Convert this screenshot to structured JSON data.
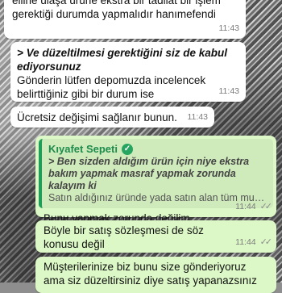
{
  "messages": [
    {
      "text": "elline ulaşa ürüne ekstra bir tadilat bir işlem gerektiği durumda yapmalıdır hanımefendi",
      "time": "11:43"
    },
    {
      "quote": "> Ve düzeltilmesi gerektiğini siz de kabul ediyorsunuz",
      "text": "Gönderin lütfen depomuzda incelencek belirttiğiniz gibi bir durum ise",
      "time": "11:43"
    },
    {
      "text": "Ücretsiz değişimi sağlanır bunun.",
      "time": "11:43"
    }
  ],
  "reply": {
    "sender": "Kıyafet Sepeti",
    "quoted_line": "> Ben sizden aldığım ürün için niye ekstra bakım yapmak masraf yapmak zorunda kalayım ki",
    "quoted_sub": "Satın aldığınız üründe yada satın alan tüm muster...",
    "text": "Bunu yapmak zorunda değilim",
    "time": "11:44"
  },
  "outgoing": [
    {
      "text": "Böyle bir satış sözleşmesi de söz konusu değil",
      "time": "11:44"
    },
    {
      "text": "Müşterilerinize biz bunu size gönderiyoruz ama siz düzeltirsiniz diye satış yapanazsınız"
    }
  ],
  "colors": {
    "incoming": "#ffffff",
    "outgoing": "#dcf8c6",
    "accent": "#1e9e58"
  },
  "icons": {
    "verified": "verified-check-icon",
    "read": "double-check-icon"
  }
}
